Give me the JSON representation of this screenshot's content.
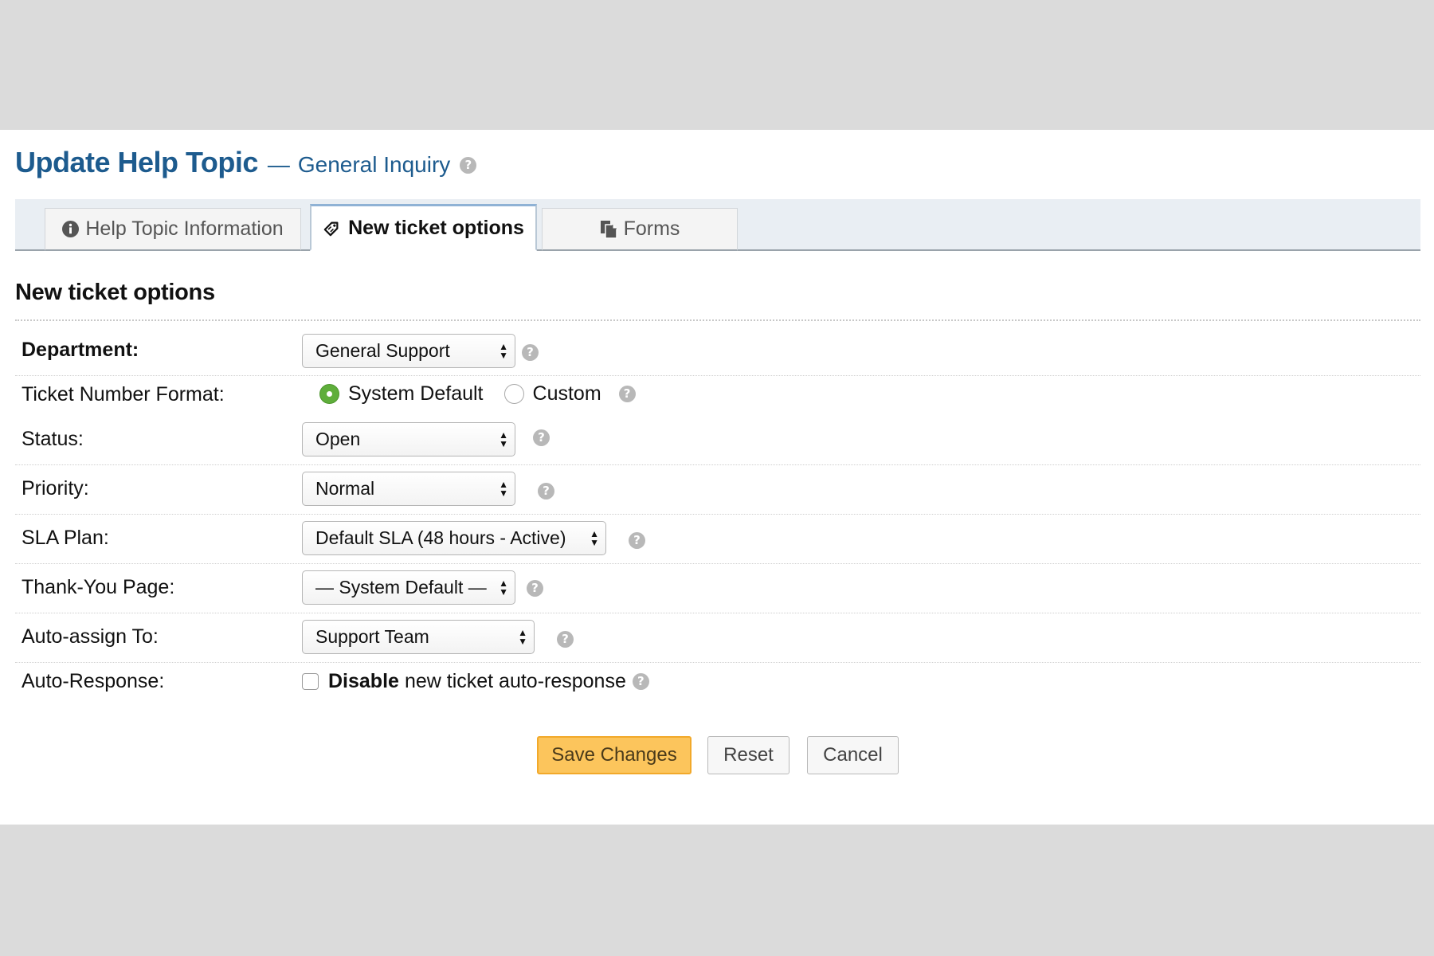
{
  "header": {
    "title": "Update Help Topic",
    "separator": "—",
    "subtitle": "General Inquiry"
  },
  "tabs": [
    {
      "label": "Help Topic Information",
      "icon": "info-circle-icon",
      "active": false
    },
    {
      "label": "New ticket options",
      "icon": "tag-icon",
      "active": true
    },
    {
      "label": "Forms",
      "icon": "copy-documents-icon",
      "active": false
    }
  ],
  "section": {
    "title": "New ticket options"
  },
  "fields": {
    "department": {
      "label": "Department:",
      "value": "General Support"
    },
    "ticket_number_format": {
      "label": "Ticket Number Format:",
      "options": [
        "System Default",
        "Custom"
      ],
      "selected": "System Default"
    },
    "status": {
      "label": "Status:",
      "value": "Open"
    },
    "priority": {
      "label": "Priority:",
      "value": "Normal"
    },
    "sla_plan": {
      "label": "SLA Plan:",
      "value": "Default SLA (48 hours - Active)"
    },
    "thank_you_page": {
      "label": "Thank-You Page:",
      "value": "— System Default —"
    },
    "auto_assign": {
      "label": "Auto-assign To:",
      "value": "Support Team"
    },
    "auto_response": {
      "label": "Auto-Response:",
      "checkbox_bold": "Disable",
      "checkbox_text": "new ticket auto-response",
      "checked": false
    }
  },
  "buttons": {
    "save": "Save Changes",
    "reset": "Reset",
    "cancel": "Cancel"
  },
  "help_icon_glyph": "?",
  "colors": {
    "title": "#1d5b8e",
    "primary_button": "#fcc55c",
    "radio_selected": "#5fae3b",
    "background": "#dbdbdb"
  }
}
